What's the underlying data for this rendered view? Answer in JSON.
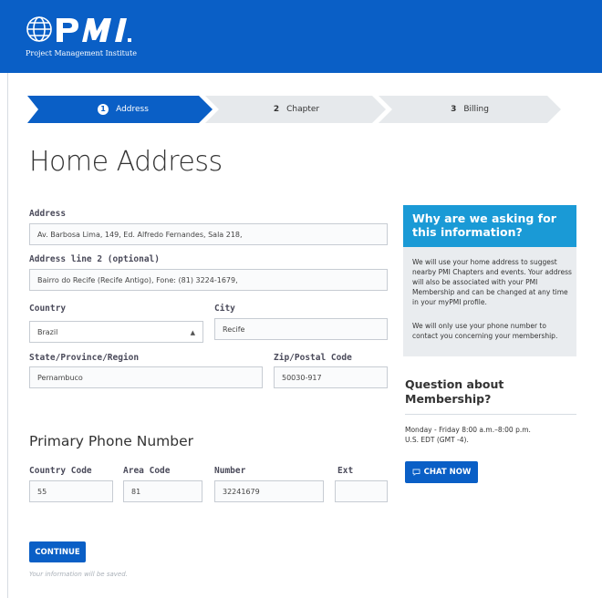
{
  "header": {
    "logo_text": "PMI",
    "logo_subtitle": "Project Management Institute"
  },
  "steps": [
    {
      "num": "1",
      "label": "Address",
      "active": true
    },
    {
      "num": "2",
      "label": "Chapter",
      "active": false
    },
    {
      "num": "3",
      "label": "Billing",
      "active": false
    }
  ],
  "page_title": "Home Address",
  "form": {
    "address_label": "Address",
    "address_value": "Av. Barbosa Lima, 149, Ed. Alfredo Fernandes, Sala 218,",
    "address2_label": "Address line 2 (optional)",
    "address2_value": "Bairro do Recife (Recife Antigo), Fone: (81) 3224-1679,",
    "country_label": "Country",
    "country_value": "Brazil",
    "city_label": "City",
    "city_value": "Recife",
    "state_label": "State/Province/Region",
    "state_value": "Pernambuco",
    "zip_label": "Zip/Postal Code",
    "zip_value": "50030-917"
  },
  "phone": {
    "title": "Primary Phone Number",
    "country_code_label": "Country Code",
    "country_code_value": "55",
    "area_code_label": "Area Code",
    "area_code_value": "81",
    "number_label": "Number",
    "number_value": "32241679",
    "ext_label": "Ext",
    "ext_value": ""
  },
  "actions": {
    "continue_label": "CONTINUE",
    "saved_note": "Your information will be saved."
  },
  "sidebar": {
    "info_title": "Why are we asking for this information?",
    "info_p1": "We will use your home address to suggest nearby PMI Chapters and events. Your address will also be associated with your PMI Membership and can be changed at any time in your myPMI profile.",
    "info_p2": "We will only use your phone number to contact you concerning your membership.",
    "question_title": "Question about Membership?",
    "hours_line1": "Monday - Friday 8:00 a.m.–8:00 p.m.",
    "hours_line2": "U.S. EDT (GMT -4).",
    "chat_label": "CHAT NOW"
  },
  "colors": {
    "brand_blue": "#0a5fc6",
    "info_blue": "#1a9ad6",
    "step_idle": "#e6e9ec"
  }
}
